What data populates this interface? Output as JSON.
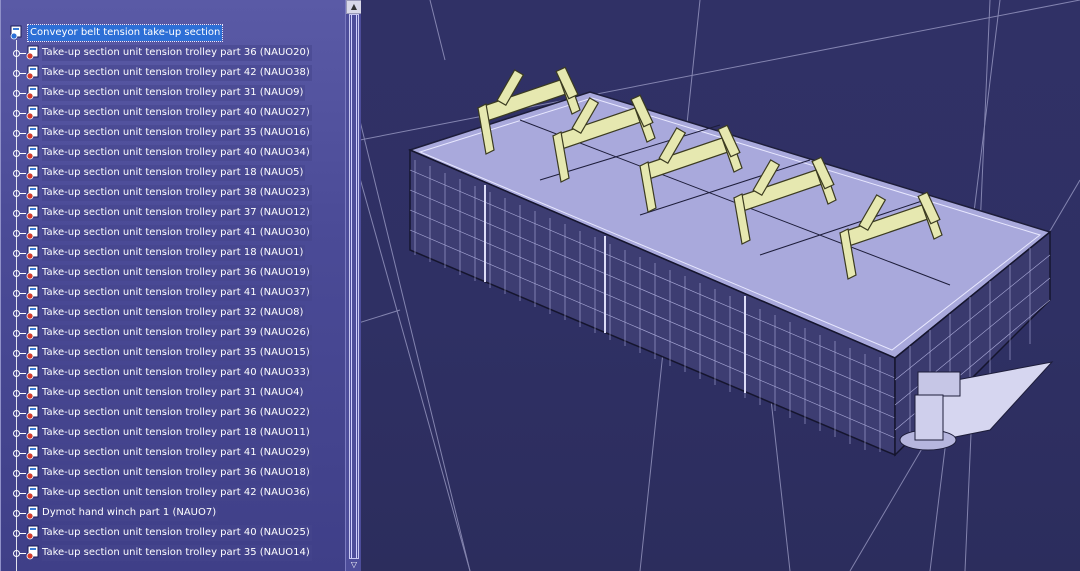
{
  "tree": {
    "root": {
      "label": "Conveyor belt tension take-up section",
      "icon": "product-assembly-icon"
    },
    "items": [
      {
        "label": "Take-up section unit tension trolley part 36 (NAUO20)",
        "icon": "part-icon"
      },
      {
        "label": "Take-up section unit tension trolley part 42 (NAUO38)",
        "icon": "part-icon"
      },
      {
        "label": "Take-up section unit tension trolley part 31 (NAUO9)",
        "icon": "part-icon"
      },
      {
        "label": "Take-up section unit tension trolley part 40 (NAUO27)",
        "icon": "part-icon"
      },
      {
        "label": "Take-up section unit tension trolley part 35 (NAUO16)",
        "icon": "part-icon"
      },
      {
        "label": "Take-up section unit tension trolley part 40 (NAUO34)",
        "icon": "part-icon"
      },
      {
        "label": "Take-up section unit tension trolley part 18 (NAUO5)",
        "icon": "part-icon"
      },
      {
        "label": "Take-up section unit tension trolley part 38 (NAUO23)",
        "icon": "part-icon"
      },
      {
        "label": "Take-up section unit tension trolley part 37 (NAUO12)",
        "icon": "part-icon"
      },
      {
        "label": "Take-up section unit tension trolley part 41 (NAUO30)",
        "icon": "part-icon"
      },
      {
        "label": "Take-up section unit tension trolley part 18 (NAUO1)",
        "icon": "part-icon"
      },
      {
        "label": "Take-up section unit tension trolley part 36 (NAUO19)",
        "icon": "part-icon"
      },
      {
        "label": "Take-up section unit tension trolley part 41 (NAUO37)",
        "icon": "part-icon"
      },
      {
        "label": "Take-up section unit tension trolley part 32 (NAUO8)",
        "icon": "part-icon"
      },
      {
        "label": "Take-up section unit tension trolley part 39 (NAUO26)",
        "icon": "part-icon"
      },
      {
        "label": "Take-up section unit tension trolley part 35 (NAUO15)",
        "icon": "part-icon"
      },
      {
        "label": "Take-up section unit tension trolley part 40 (NAUO33)",
        "icon": "part-icon"
      },
      {
        "label": "Take-up section unit tension trolley part 31 (NAUO4)",
        "icon": "part-icon"
      },
      {
        "label": "Take-up section unit tension trolley part 36 (NAUO22)",
        "icon": "part-icon"
      },
      {
        "label": "Take-up section unit tension trolley part 18 (NAUO11)",
        "icon": "part-icon"
      },
      {
        "label": "Take-up section unit tension trolley part 41 (NAUO29)",
        "icon": "part-icon"
      },
      {
        "label": "Take-up section unit tension trolley part 36 (NAUO18)",
        "icon": "part-icon"
      },
      {
        "label": "Take-up section unit tension trolley part 42 (NAUO36)",
        "icon": "part-icon"
      },
      {
        "label": "Dymot hand winch part 1 (NAUO7)",
        "icon": "part-icon"
      },
      {
        "label": "Take-up section unit tension trolley part 40 (NAUO25)",
        "icon": "part-icon"
      },
      {
        "label": "Take-up section unit tension trolley part 35 (NAUO14)",
        "icon": "part-icon"
      }
    ]
  },
  "scrollbar": {
    "up_glyph": "▲",
    "down_glyph": "▽"
  },
  "colors": {
    "viewport_background": "#2f3064",
    "tree_background": "#4b4b97",
    "selection": "#2d6fd6",
    "idler_roller": "#e6e8b0",
    "frame": "#c8c8ec"
  }
}
